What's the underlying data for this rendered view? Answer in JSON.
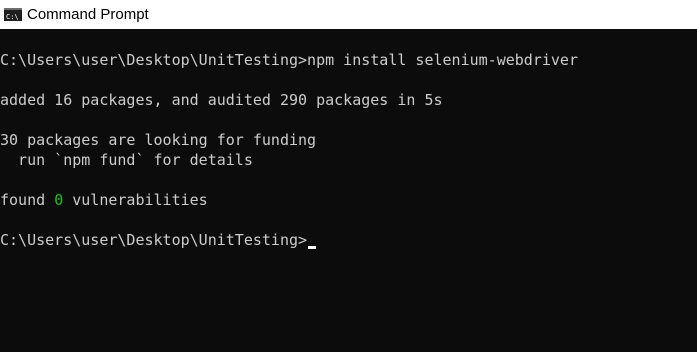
{
  "window": {
    "title": "Command Prompt",
    "icon": "cmd-icon",
    "icon_text": "C:\\",
    "background_color": "#0c0c0c",
    "text_color": "#cccccc",
    "highlight_color": "#16c60c"
  },
  "console": {
    "line1": "C:\\Users\\user\\Desktop\\UnitTesting>npm install selenium-webdriver",
    "line2": "added 16 packages, and audited 290 packages in 5s",
    "line3": "30 packages are looking for funding",
    "line4": "  run `npm fund` for details",
    "line5": {
      "prefix": "found ",
      "count": "0",
      "suffix": " vulnerabilities"
    },
    "prompt": "C:\\Users\\user\\Desktop\\UnitTesting>"
  }
}
